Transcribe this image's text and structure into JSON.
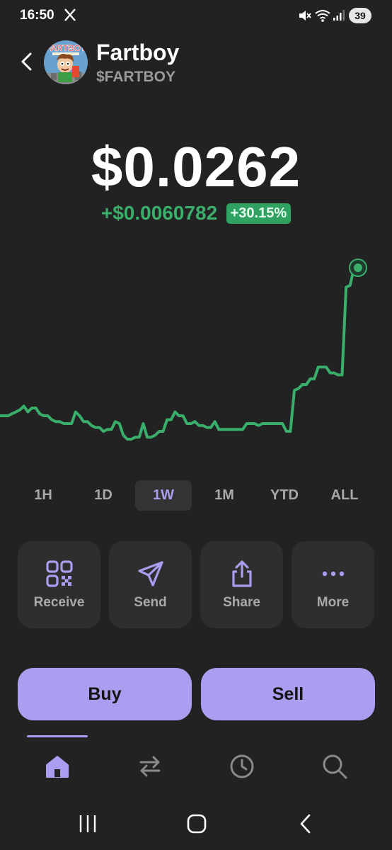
{
  "status_bar": {
    "time": "16:50",
    "battery": "39"
  },
  "header": {
    "token_name": "Fartboy",
    "token_symbol": "$FARTBOY",
    "avatar_text": "FARTBOY"
  },
  "price": {
    "value": "$0.0262",
    "change_amount": "+$0.0060782",
    "change_percent": "+30.15%"
  },
  "chart_data": {
    "type": "line",
    "x": [
      0,
      1,
      2,
      3,
      4,
      5,
      6,
      7,
      8,
      9,
      10,
      11,
      12,
      13,
      14,
      15,
      16,
      17,
      18,
      19,
      20,
      21,
      22,
      23,
      24,
      25,
      26,
      27,
      28,
      29,
      30,
      31,
      32,
      33,
      34,
      35,
      36,
      37,
      38,
      39,
      40,
      41,
      42,
      43,
      44,
      45,
      46,
      47,
      48,
      49,
      50,
      51,
      52,
      53,
      54,
      55,
      56,
      57,
      58,
      59,
      60,
      61,
      62,
      63,
      64,
      65,
      66,
      67,
      68,
      69,
      70,
      71,
      72,
      73,
      74,
      75,
      76,
      77,
      78,
      79,
      80,
      81,
      82,
      83,
      84,
      85,
      86,
      87,
      88,
      89,
      90
    ],
    "values": [
      0.0186,
      0.0186,
      0.0186,
      0.0187,
      0.0188,
      0.0189,
      0.0191,
      0.0188,
      0.019,
      0.019,
      0.0187,
      0.0186,
      0.0186,
      0.0184,
      0.0183,
      0.0183,
      0.0182,
      0.0182,
      0.0182,
      0.0188,
      0.0186,
      0.0183,
      0.0183,
      0.0181,
      0.018,
      0.018,
      0.0178,
      0.0179,
      0.0179,
      0.0183,
      0.0182,
      0.0176,
      0.0174,
      0.0174,
      0.0175,
      0.0175,
      0.0182,
      0.0175,
      0.0175,
      0.0176,
      0.0178,
      0.0178,
      0.0184,
      0.0184,
      0.0188,
      0.0186,
      0.0186,
      0.0182,
      0.0182,
      0.0183,
      0.0181,
      0.0181,
      0.018,
      0.018,
      0.0183,
      0.0179,
      0.0179,
      0.0179,
      0.0179,
      0.0179,
      0.0179,
      0.0179,
      0.0182,
      0.0182,
      0.0182,
      0.0181,
      0.0182,
      0.0182,
      0.0182,
      0.0182,
      0.0182,
      0.0182,
      0.0178,
      0.0178,
      0.0199,
      0.02,
      0.0202,
      0.0202,
      0.0205,
      0.0205,
      0.0211,
      0.0211,
      0.0211,
      0.0208,
      0.0208,
      0.0207,
      0.0207,
      0.0252,
      0.0253,
      0.0262,
      0.0262
    ],
    "color": "#3aae6b",
    "title": "",
    "xlabel": "",
    "ylabel": "",
    "grid": false,
    "legend": "none"
  },
  "ranges": [
    {
      "label": "1H",
      "active": false
    },
    {
      "label": "1D",
      "active": false
    },
    {
      "label": "1W",
      "active": true
    },
    {
      "label": "1M",
      "active": false
    },
    {
      "label": "YTD",
      "active": false
    },
    {
      "label": "ALL",
      "active": false
    }
  ],
  "actions": [
    {
      "label": "Receive",
      "icon": "qr-code-icon"
    },
    {
      "label": "Send",
      "icon": "send-icon"
    },
    {
      "label": "Share",
      "icon": "share-icon"
    },
    {
      "label": "More",
      "icon": "more-icon"
    }
  ],
  "trade": {
    "buy_label": "Buy",
    "sell_label": "Sell"
  },
  "bottom_tabs": [
    "home-icon",
    "swap-icon",
    "history-icon",
    "search-icon"
  ],
  "colors": {
    "background": "#222222",
    "accent": "#a99df0",
    "positive": "#3aae6b",
    "card": "#2e2e2e"
  }
}
